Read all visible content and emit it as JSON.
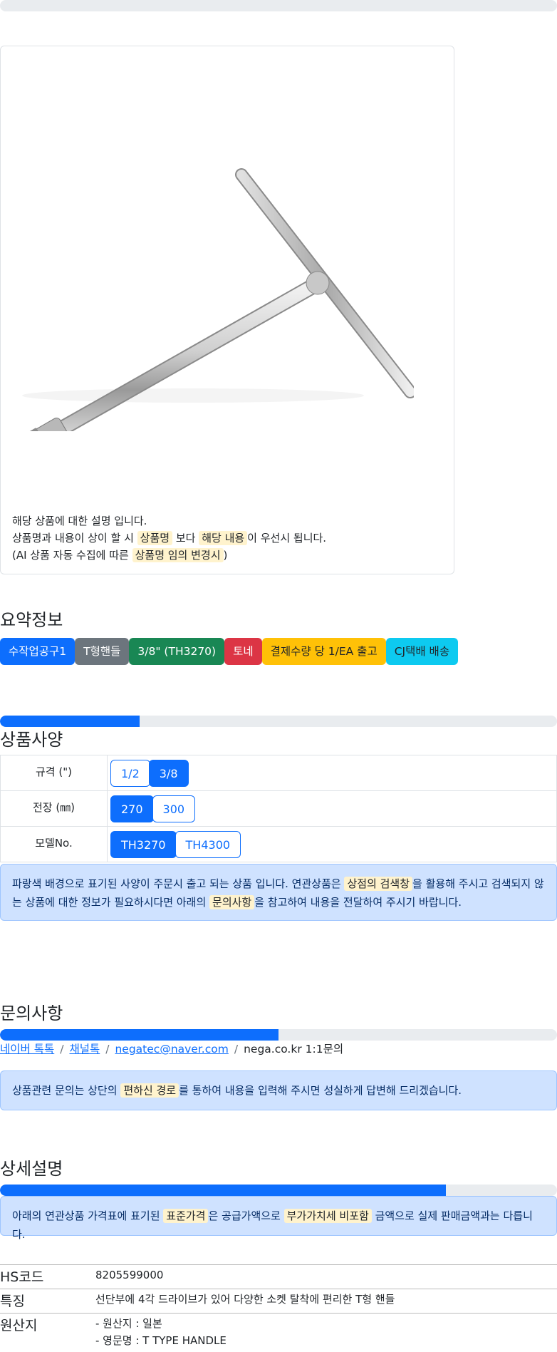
{
  "progress": {
    "top": 0,
    "second": 0.25,
    "third": 0.5,
    "fourth": 0.8
  },
  "description": {
    "line1": "해당 상품에 대한 설명 입니다.",
    "line2_a": "상품명과 내용이 상이 할 시 ",
    "line2_hl1": "상품명",
    "line2_b": " 보다 ",
    "line2_hl2": "해당 내용",
    "line2_c": "이 우선시 됩니다.",
    "line3_a": "(AI 상품 자동 수집에 따른 ",
    "line3_hl": "상품명 임의 변경시",
    "line3_b": ")"
  },
  "summary": {
    "title": "요약정보",
    "badges": [
      {
        "label": "수작업공구1",
        "color": "#0d6efd"
      },
      {
        "label": "T형핸들",
        "color": "#6c757d"
      },
      {
        "label": "3/8\" (TH3270)",
        "color": "#198754"
      },
      {
        "label": "토네",
        "color": "#dc3545"
      },
      {
        "label": "결제수량 당 1/EA 출고",
        "color": "#ffc107"
      },
      {
        "label": "CJ택배 배송",
        "color": "#0dcaf0"
      }
    ]
  },
  "spec": {
    "title": "상품사양",
    "rows": [
      {
        "key": "규격 (\")",
        "options": [
          "1/2",
          "3/8"
        ],
        "selected": 1
      },
      {
        "key": "전장 (㎜)",
        "options": [
          "270",
          "300"
        ],
        "selected": 0
      },
      {
        "key": "모델No.",
        "options": [
          "TH3270",
          "TH4300"
        ],
        "selected": 0
      }
    ],
    "notice_a": "파랑색 배경으로 표기된 사양이 주문시 출고 되는 상품 입니다. 연관상품은 ",
    "notice_hl1": "상점의 검색창",
    "notice_b": "을 활용해 주시고 검색되지 않는 상품에 대한 정보가 필요하시다면 아래의 ",
    "notice_hl2": "문의사항",
    "notice_c": "을 참고하여 내용을 전달하여 주시기 바랍니다."
  },
  "inquiry": {
    "title": "문의사항",
    "links": [
      "네이버 톡톡",
      "채널톡",
      "negatec@naver.com"
    ],
    "plain": "nega.co.kr 1:1문의",
    "notice_a": "상품관련 문의는 상단의 ",
    "notice_hl": "편하신 경로",
    "notice_b": "를 통하여 내용을 입력해 주시면 성실하게 답변해 드리겠습니다."
  },
  "detail": {
    "title": "상세설명",
    "notice_a": "아래의 연관상품 가격표에 표기된 ",
    "notice_hl1": "표준가격",
    "notice_b": "은 공급가액으로 ",
    "notice_hl2": "부가가치세 비포함",
    "notice_c": " 금액으로 실제 판매금액과는 다릅니다.",
    "rows": [
      {
        "key": "HS코드",
        "value": "8205599000"
      },
      {
        "key": "특징",
        "value": "선단부에 4각 드라이브가 있어 다양한 소켓 탈착에 편리한 T형 핸들"
      },
      {
        "key": "원산지",
        "value1": "- 원산지 : 일본",
        "value2": "- 영문명 : T TYPE HANDLE"
      }
    ]
  }
}
